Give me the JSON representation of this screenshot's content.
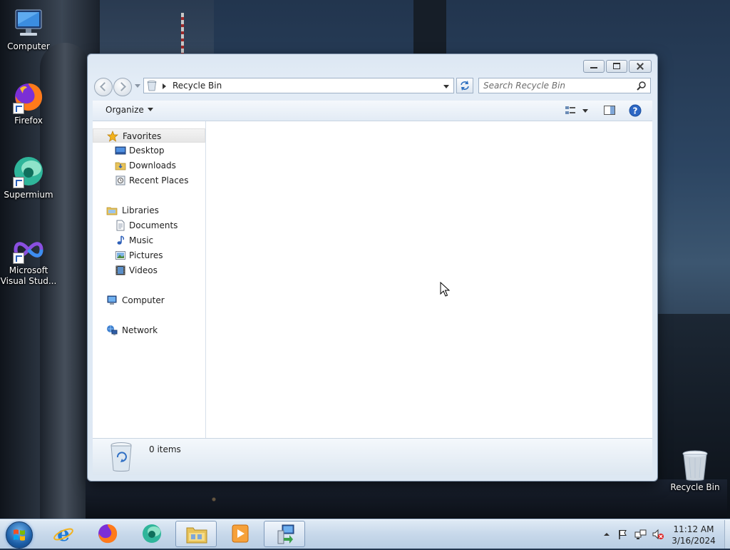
{
  "desktop": {
    "icons": [
      {
        "label": "Computer",
        "icon": "computer-icon"
      },
      {
        "label": "Firefox",
        "icon": "firefox-icon"
      },
      {
        "label": "Supermium",
        "icon": "supermium-icon"
      },
      {
        "label": "Microsoft Visual Stud...",
        "icon": "visual-studio-icon"
      },
      {
        "label": "Recycle Bin",
        "icon": "recycle-bin-icon"
      }
    ]
  },
  "window": {
    "address": "Recycle Bin",
    "search_placeholder": "Search Recycle Bin",
    "organize_label": "Organize",
    "nav": {
      "favorites": "Favorites",
      "favorites_items": [
        "Desktop",
        "Downloads",
        "Recent Places"
      ],
      "libraries": "Libraries",
      "libraries_items": [
        "Documents",
        "Music",
        "Pictures",
        "Videos"
      ],
      "computer": "Computer",
      "network": "Network"
    },
    "details": {
      "item_count": "0 items"
    }
  },
  "taskbar": {
    "pinned": [
      "Internet Explorer",
      "Firefox",
      "Supermium",
      "Windows Explorer",
      "Windows Media Player",
      "Remote Desktop"
    ],
    "clock_time": "11:12 AM",
    "clock_date": "3/16/2024"
  },
  "colors": {
    "window_frame": "#dce7f3",
    "taskbar": "#c7d8ea",
    "accent": "#1d5fa8"
  }
}
